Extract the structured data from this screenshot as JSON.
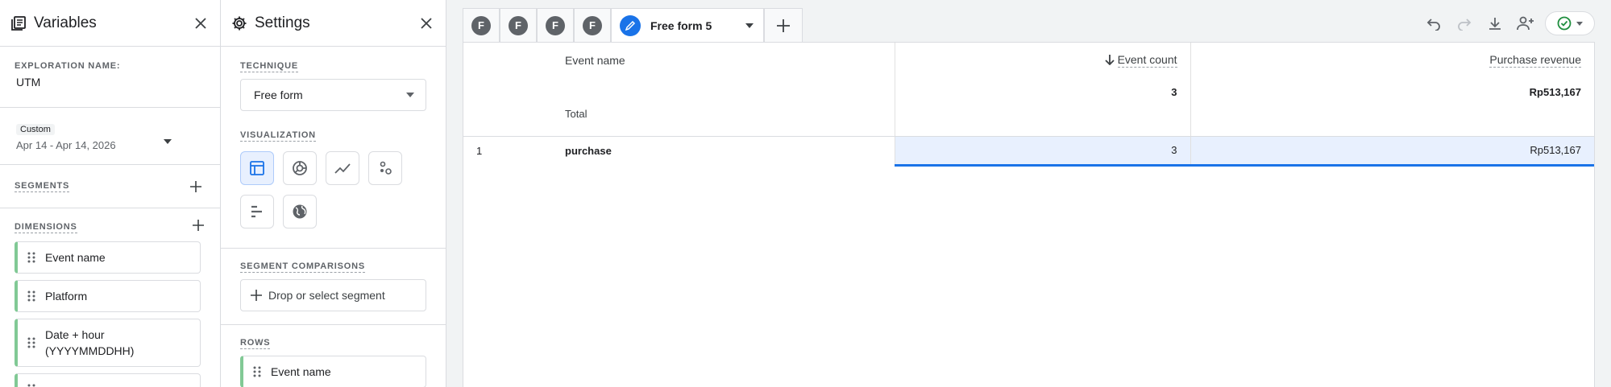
{
  "variables": {
    "title": "Variables",
    "exploration_label": "EXPLORATION NAME:",
    "exploration_name": "UTM",
    "date_chip": "Custom",
    "date_range": "Apr 14 - Apr 14, 2026",
    "segments_label": "SEGMENTS",
    "dimensions_label": "DIMENSIONS",
    "dimensions": [
      {
        "label": "Event name"
      },
      {
        "label": "Platform"
      },
      {
        "label": "Date + hour (YYYYMMDDHH)"
      }
    ]
  },
  "settings": {
    "title": "Settings",
    "technique_label": "TECHNIQUE",
    "technique_value": "Free form",
    "visualization_label": "VISUALIZATION",
    "segment_comparisons_label": "SEGMENT COMPARISONS",
    "drop_segment": "Drop or select segment",
    "rows_label": "ROWS",
    "rows_item": "Event name"
  },
  "tabs": {
    "avatars": [
      "F",
      "F",
      "F",
      "F"
    ],
    "active_label": "Free form 5"
  },
  "table": {
    "header_dimension": "Event name",
    "header_metric_1": "Event count",
    "header_metric_2": "Purchase revenue",
    "total_label": "Total",
    "total_metric_1": "3",
    "total_metric_2": "Rp513,167",
    "rows": [
      {
        "index": "1",
        "name": "purchase",
        "metric_1": "3",
        "metric_2": "Rp513,167"
      }
    ]
  },
  "colors": {
    "accent": "#1a73e8",
    "dimension_bar": "#81c995",
    "status_ok": "#1e8e3e"
  },
  "icons": [
    "variables-icon",
    "gear-icon",
    "close-icon",
    "plus-icon",
    "drag-handle-icon",
    "chevron-down-icon",
    "table-icon",
    "donut-icon",
    "line-chart-icon",
    "scatter-icon",
    "bar-chart-icon",
    "globe-icon",
    "pencil-icon",
    "undo-icon",
    "redo-icon",
    "download-icon",
    "share-icon",
    "check-circle-icon",
    "arrow-down-icon"
  ]
}
